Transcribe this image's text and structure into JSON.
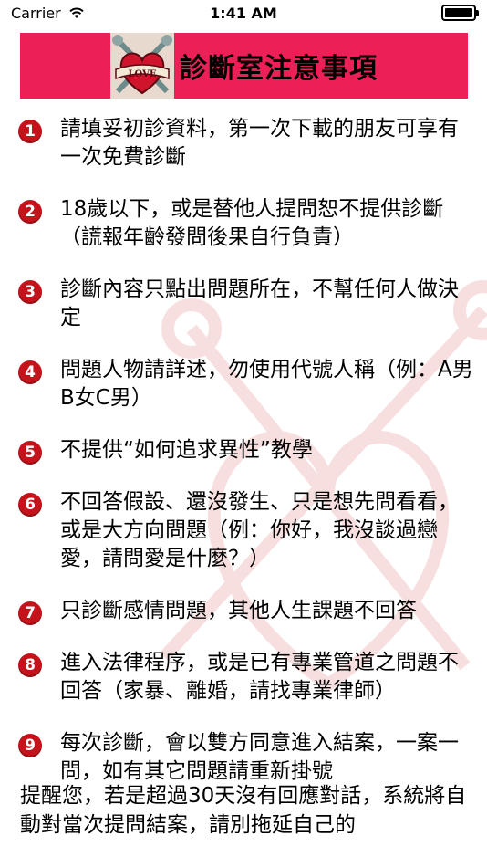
{
  "status_bar": {
    "carrier": "Carrier",
    "time": "1:41 AM"
  },
  "banner": {
    "logo_text": "LOVE",
    "title": "診斷室注意事項"
  },
  "rules": [
    {
      "number": "1",
      "text": "請填妥初診資料，第一次下載的朋友可享有一次免費診斷"
    },
    {
      "number": "2",
      "text": "18歲以下，或是替他人提問恕不提供診斷（謊報年齡發問後果自行負責）"
    },
    {
      "number": "3",
      "text": "診斷內容只點出問題所在，不幫任何人做決定"
    },
    {
      "number": "4",
      "text": "問題人物請詳述，勿使用代號人稱（例：A男B女C男）"
    },
    {
      "number": "5",
      "text": "不提供“如何追求異性”教學"
    },
    {
      "number": "6",
      "text": "不回答假設、還沒發生、只是想先問看看，或是大方向問題（例：你好，我沒談過戀愛，請問愛是什麼？）"
    },
    {
      "number": "7",
      "text": "只診斷感情問題，其他人生課題不回答"
    },
    {
      "number": "8",
      "text": "進入法律程序，或是已有專業管道之問題不回答（家暴、離婚，請找專業律師）"
    },
    {
      "number": "9",
      "text": "每次診斷，會以雙方同意進入結案，一案一問，如有其它問題請重新掛號"
    }
  ],
  "reminder": "提醒您，若是超過30天沒有回應對話，系統將自動對當次提問結案，請別拖延自己的",
  "colors": {
    "banner": "#ec1f56",
    "number_badge": "#c5131c"
  },
  "icons": {
    "wifi": "wifi-icon",
    "battery": "battery-icon",
    "logo": "heart-love-logo"
  }
}
